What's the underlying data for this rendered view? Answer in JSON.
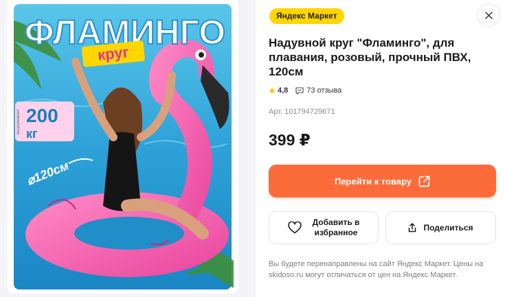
{
  "image": {
    "headline": "ФЛАМИНГО",
    "subhead": "круг",
    "capacity_value": "200",
    "capacity_unit": "кг",
    "capacity_caption": "выдерживает",
    "diameter": "⌀120см"
  },
  "badge": "Яндекс Маркет",
  "product": {
    "title": "Надувной круг \"Фламинго\", для плавания, розовый, прочный ПВХ, 120см",
    "rating": "4,8",
    "reviews": "73 отзыва",
    "article": "Арт. 101794729671",
    "price": "399 ₽"
  },
  "buttons": {
    "go": "Перейти к товару",
    "favorite_line1": "Добавить в",
    "favorite_line2": "избранное",
    "share": "Поделиться"
  },
  "disclaimer": "Вы будете перенаправлены на сайт Яндекс Маркет. Цены на skidoso.ru могут отличаться от цен на Яндекс Маркет.",
  "colors": {
    "accent": "#fc6c3a",
    "badge": "#ffd600",
    "pink": "#f45fb0"
  }
}
